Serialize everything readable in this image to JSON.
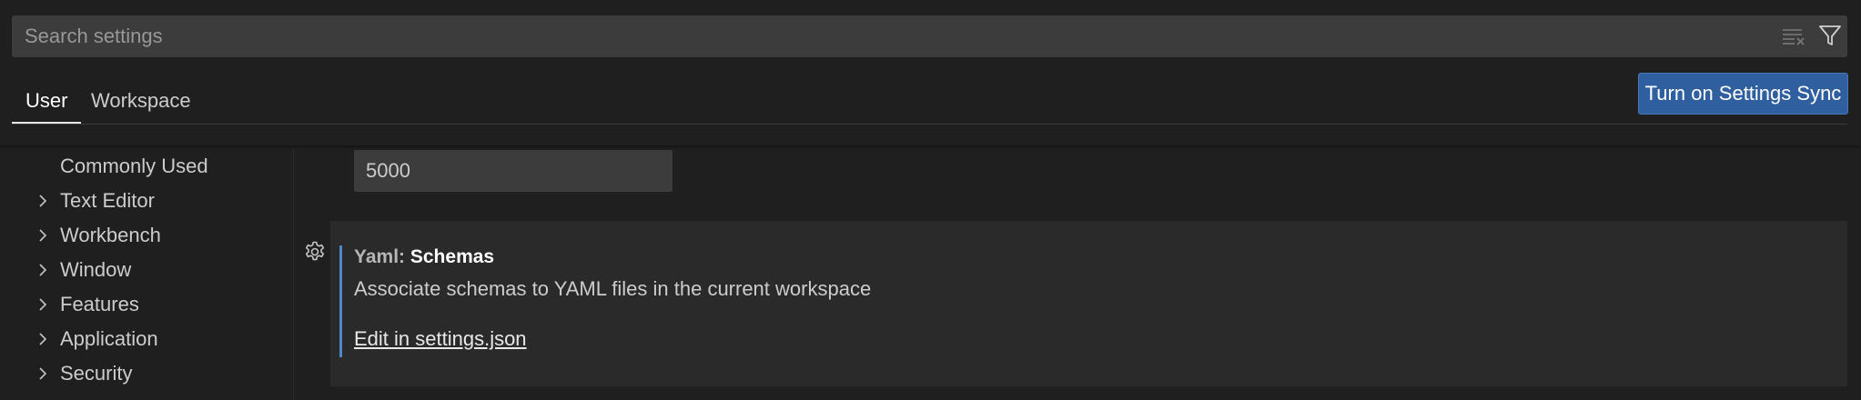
{
  "search": {
    "placeholder": "Search settings",
    "clear_icon": "clear-filter-icon",
    "filter_icon": "filter-icon"
  },
  "tabs": [
    {
      "label": "User",
      "active": true
    },
    {
      "label": "Workspace",
      "active": false
    }
  ],
  "sync_button": {
    "label": "Turn on Settings Sync",
    "color": "#2f5f9e"
  },
  "sidebar": {
    "items": [
      {
        "label": "Commonly Used",
        "expandable": false
      },
      {
        "label": "Text Editor",
        "expandable": true
      },
      {
        "label": "Workbench",
        "expandable": true
      },
      {
        "label": "Window",
        "expandable": true
      },
      {
        "label": "Features",
        "expandable": true
      },
      {
        "label": "Application",
        "expandable": true
      },
      {
        "label": "Security",
        "expandable": true
      }
    ]
  },
  "main": {
    "number_value": "5000",
    "setting": {
      "category": "Yaml: ",
      "key": "Schemas",
      "description": "Associate schemas to YAML files in the current workspace",
      "link": "Edit in settings.json",
      "gear_icon": "gear-icon",
      "accent_color": "#4f86c6"
    }
  }
}
